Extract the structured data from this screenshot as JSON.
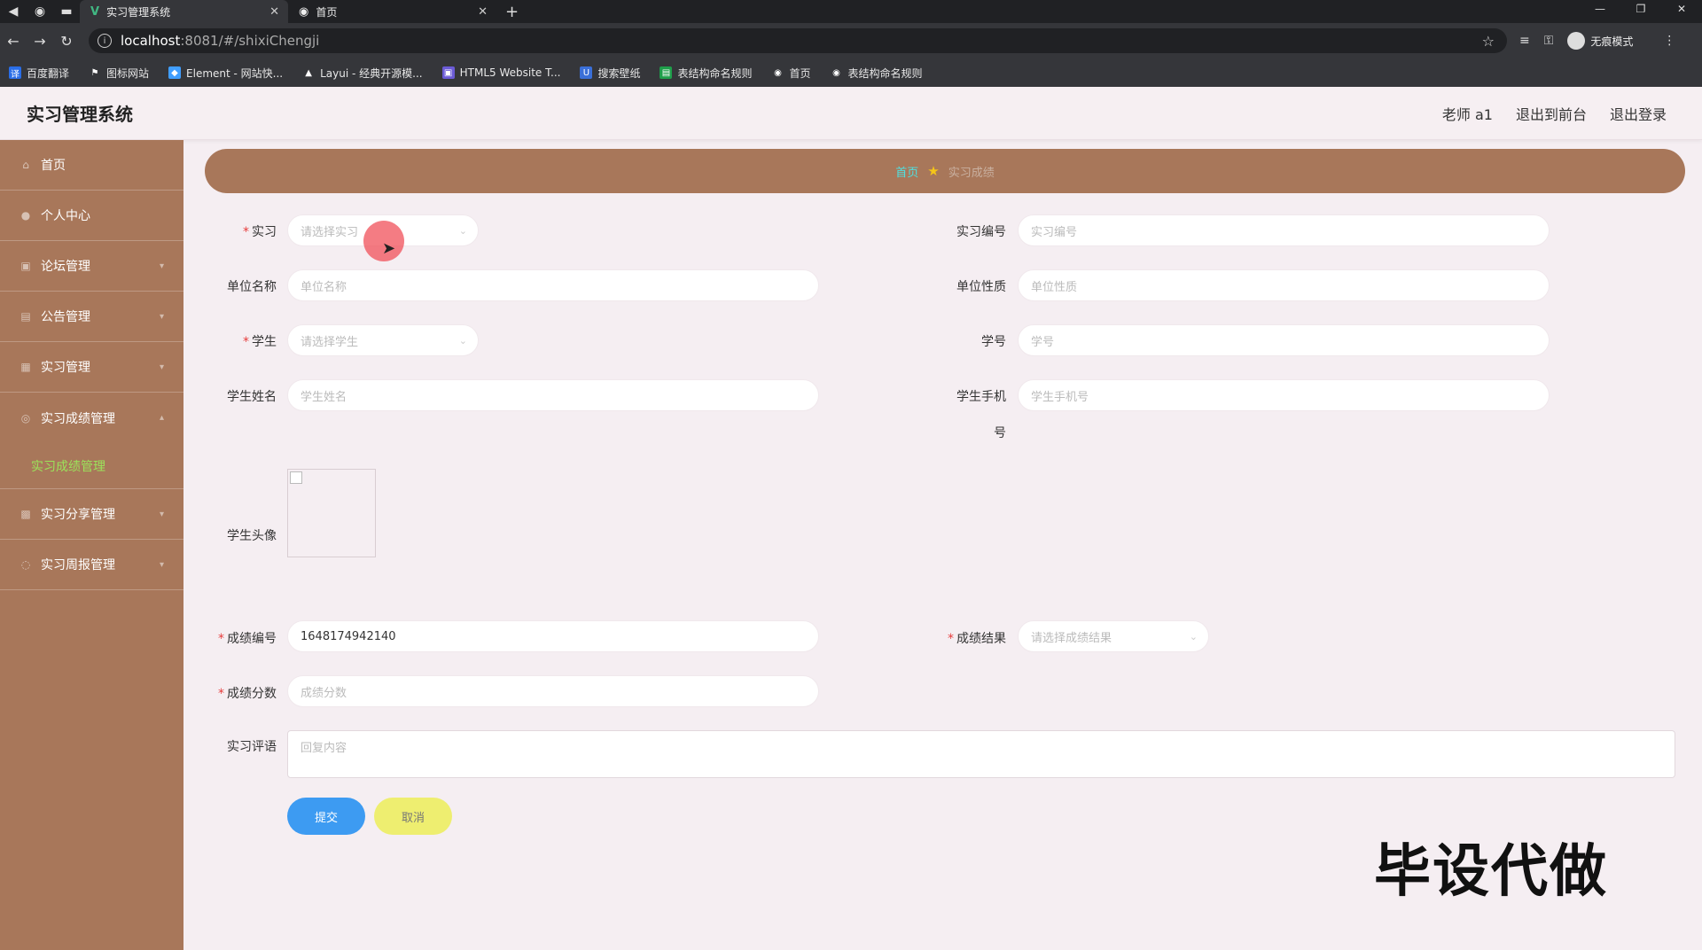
{
  "browser": {
    "tabs": [
      {
        "label": "实习管理系统",
        "active": true
      },
      {
        "label": "首页",
        "active": false
      }
    ],
    "url_host": "localhost",
    "url_path": ":8081/#/shixiChengji",
    "incognito_label": "无痕模式",
    "bookmarks": [
      "百度翻译",
      "图标网站",
      "Element - 网站快...",
      "Layui - 经典开源模...",
      "HTML5 Website T...",
      "搜索壁纸",
      "表结构命名规则",
      "首页",
      "表结构命名规则"
    ]
  },
  "header": {
    "title": "实习管理系统",
    "user": "老师 a1",
    "back_to_front": "退出到前台",
    "logout": "退出登录"
  },
  "sidebar": {
    "items": [
      "首页",
      "个人中心",
      "论坛管理",
      "公告管理",
      "实习管理",
      "实习成绩管理"
    ],
    "active_sub": "实习成绩管理",
    "items_after": [
      "实习分享管理",
      "实习周报管理"
    ]
  },
  "breadcrumb": {
    "home": "首页",
    "current": "实习成绩"
  },
  "form": {
    "shixi": {
      "label": "实习",
      "placeholder": "请选择实习"
    },
    "shixi_no": {
      "label": "实习编号",
      "placeholder": "实习编号"
    },
    "unit_name": {
      "label": "单位名称",
      "placeholder": "单位名称"
    },
    "unit_type": {
      "label": "单位性质",
      "placeholder": "单位性质"
    },
    "student": {
      "label": "学生",
      "placeholder": "请选择学生"
    },
    "student_no": {
      "label": "学号",
      "placeholder": "学号"
    },
    "student_name": {
      "label": "学生姓名",
      "placeholder": "学生姓名"
    },
    "student_phone": {
      "label_line1": "学生手机",
      "label_line2": "号",
      "placeholder": "学生手机号"
    },
    "student_avatar": {
      "label": "学生头像"
    },
    "score_no": {
      "label": "成绩编号",
      "value": "1648174942140"
    },
    "score_result": {
      "label": "成绩结果",
      "placeholder": "请选择成绩结果"
    },
    "score": {
      "label": "成绩分数",
      "placeholder": "成绩分数"
    },
    "comment": {
      "label": "实习评语",
      "placeholder": "回复内容"
    }
  },
  "buttons": {
    "submit": "提交",
    "cancel": "取消"
  },
  "watermark": "毕设代做"
}
